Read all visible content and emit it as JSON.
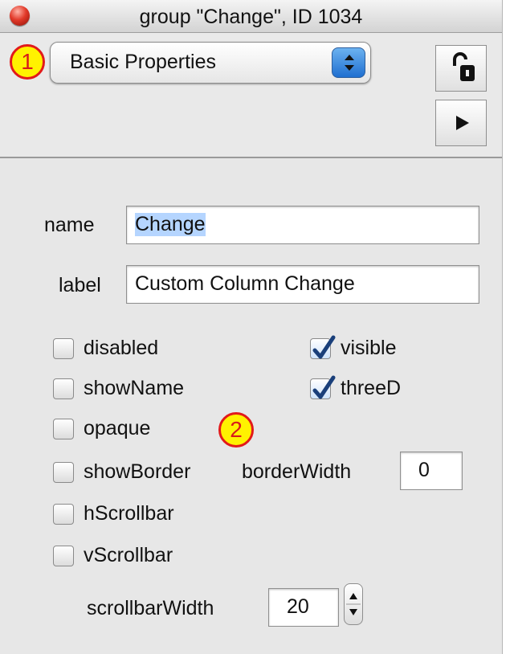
{
  "window": {
    "title": "group \"Change\", ID 1034"
  },
  "header": {
    "property_set": "Basic Properties",
    "lock_icon": "unlocked-padlock-icon",
    "play_icon": "play-triangle-icon"
  },
  "markers": {
    "m1": "1",
    "m2": "2"
  },
  "fields": {
    "name": {
      "label": "name",
      "value": "Change"
    },
    "label": {
      "label": "label",
      "value": "Custom Column Change"
    }
  },
  "checkboxes": {
    "disabled": {
      "label": "disabled",
      "checked": false
    },
    "visible": {
      "label": "visible",
      "checked": true
    },
    "showName": {
      "label": "showName",
      "checked": false
    },
    "threeD": {
      "label": "threeD",
      "checked": true
    },
    "opaque": {
      "label": "opaque",
      "checked": false
    },
    "showBorder": {
      "label": "showBorder",
      "checked": false
    },
    "hScrollbar": {
      "label": "hScrollbar",
      "checked": false
    },
    "vScrollbar": {
      "label": "vScrollbar",
      "checked": false
    }
  },
  "border_width": {
    "label": "borderWidth",
    "value": "0"
  },
  "scrollbar_width": {
    "label": "scrollbarWidth",
    "value": "20"
  },
  "colors": {
    "accent": "#2f7bd9",
    "marker_fill": "#fff200",
    "marker_border": "#e21a1a",
    "selection": "#b5d5ff"
  }
}
